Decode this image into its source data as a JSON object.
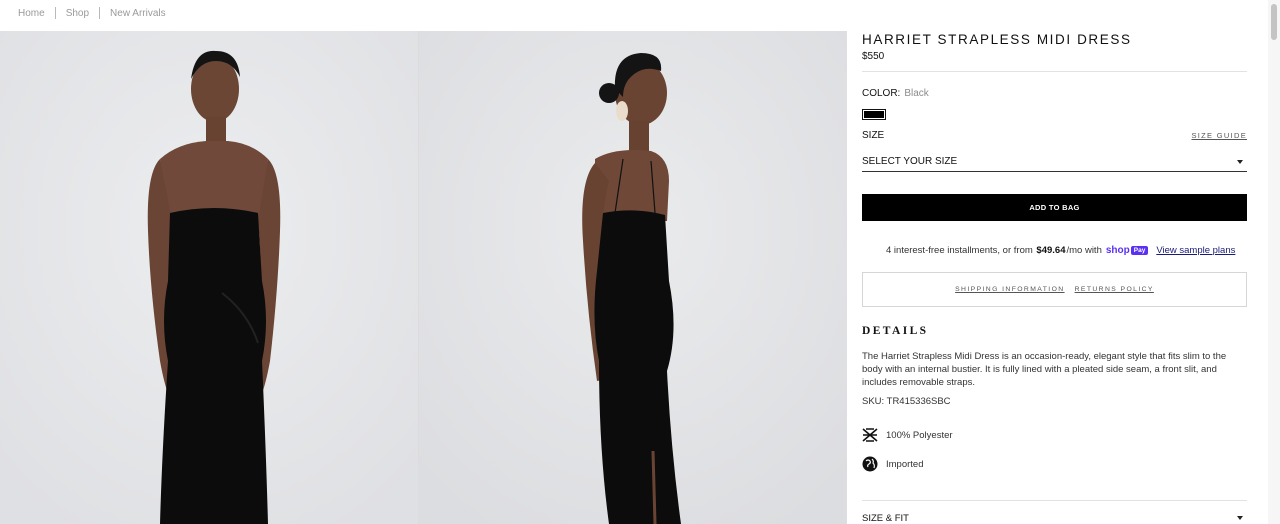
{
  "breadcrumb": [
    "Home",
    "Shop",
    "New Arrivals"
  ],
  "gallery": {
    "images": [
      {
        "name": "model-front-view"
      },
      {
        "name": "model-side-view"
      }
    ]
  },
  "product": {
    "title": "HARRIET STRAPLESS MIDI DRESS",
    "price": "$550",
    "color_label": "COLOR:",
    "color_value": "Black",
    "swatch_color": "#000000",
    "size_label": "SIZE",
    "size_guide": "SIZE GUIDE",
    "size_select": "SELECT YOUR SIZE",
    "add_to_bag": "ADD TO BAG"
  },
  "installments": {
    "text_before": "4 interest-free installments, or from",
    "amount": "$49.64",
    "text_after": "/mo with",
    "shop_word": "shop",
    "shop_pay_badge": "Pay",
    "view_plans": "View sample plans"
  },
  "info_links": {
    "shipping": "SHIPPING INFORMATION",
    "returns": "RETURNS POLICY"
  },
  "details": {
    "heading": "DETAILS",
    "description": "The Harriet Strapless Midi Dress is an occasion-ready, elegant style that fits slim to the body with an internal bustier. It is fully lined with a pleated side seam, a front slit, and includes removable straps.",
    "sku": "SKU: TR415336SBC",
    "features": [
      {
        "icon": "fabric-icon",
        "label": "100% Polyester"
      },
      {
        "icon": "globe-icon",
        "label": "Imported"
      }
    ]
  },
  "size_fit": "SIZE & FIT",
  "colors": {
    "accent": "#000000",
    "shop_pay": "#5a31f4"
  }
}
